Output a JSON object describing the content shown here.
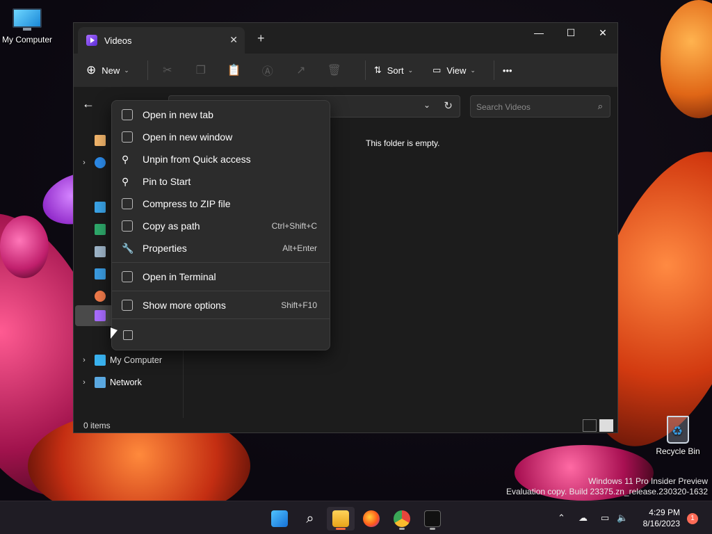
{
  "desktop": {
    "icons": [
      {
        "label": "My Computer"
      },
      {
        "label": "Recycle Bin"
      }
    ],
    "watermark": [
      "Windows 11 Pro Insider Preview",
      "Evaluation copy. Build 23375.zn_release.230320-1632"
    ]
  },
  "explorer": {
    "tab_title": "Videos",
    "tab_close": "✕",
    "new_tab": "+",
    "window_controls": {
      "minimize": "—",
      "maximize": "☐",
      "close": "✕"
    },
    "toolbar": {
      "new_label": "New",
      "sort_label": "Sort",
      "view_label": "View",
      "more_label": "•••"
    },
    "search_placeholder": "Search Videos",
    "empty_message": "This folder is empty.",
    "status_text": "0 items",
    "nav": {
      "items": [
        {
          "label": "My Computer"
        },
        {
          "label": "Network"
        }
      ]
    }
  },
  "context_menu": {
    "items": [
      {
        "label": "Open in new tab",
        "shortcut": ""
      },
      {
        "label": "Open in new window",
        "shortcut": ""
      },
      {
        "label": "Unpin from Quick access",
        "shortcut": ""
      },
      {
        "label": "Pin to Start",
        "shortcut": ""
      },
      {
        "label": "Compress to ZIP file",
        "shortcut": ""
      },
      {
        "label": "Copy as path",
        "shortcut": "Ctrl+Shift+C"
      },
      {
        "label": "Properties",
        "shortcut": "Alt+Enter"
      },
      {
        "label": "Open in Terminal",
        "shortcut": ""
      },
      {
        "label": "Show more options",
        "shortcut": "Shift+F10"
      }
    ]
  },
  "taskbar": {
    "clock_time": "4:29 PM",
    "clock_date": "8/16/2023",
    "notification_count": "1",
    "apps": [
      {
        "icon": "start-icon"
      },
      {
        "icon": "search-icon"
      },
      {
        "icon": "file-explorer-icon"
      },
      {
        "icon": "firefox-icon"
      },
      {
        "icon": "chrome-icon"
      },
      {
        "icon": "terminal-icon"
      }
    ]
  },
  "colors": {
    "accent": "#a96cff",
    "active_indicator": "#ff6b3c",
    "notification": "#ff6b57"
  }
}
